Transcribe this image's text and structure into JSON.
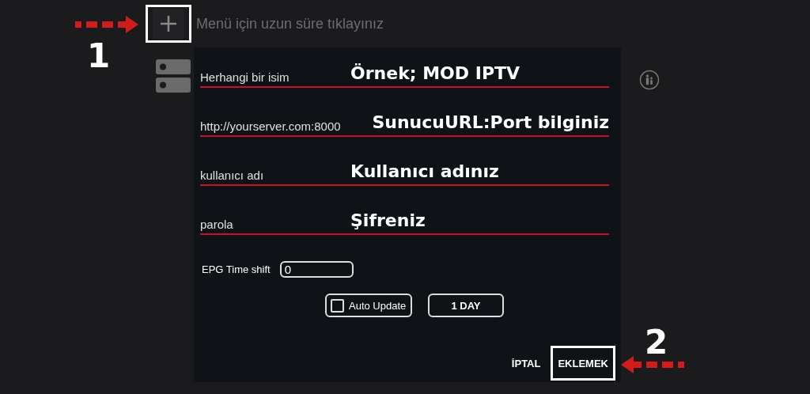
{
  "header": {
    "add_highlighted": true,
    "hint": "Menü için uzun süre tıklayınız"
  },
  "fields": [
    {
      "placeholder": "Herhangi bir isim",
      "annotation": "Örnek; MOD IPTV"
    },
    {
      "placeholder": "http://yourserver.com:8000",
      "annotation": "SunucuURL:Port bilginiz"
    },
    {
      "placeholder": "kullanıcı adı",
      "annotation": "Kullanıcı adınız"
    },
    {
      "placeholder": "parola",
      "annotation": "Şifreniz"
    }
  ],
  "epg": {
    "label": "EPG Time shift",
    "value": "0"
  },
  "auto_update": {
    "label": "Auto Update",
    "checked": false
  },
  "interval_button": "1 DAY",
  "buttons": [
    {
      "label": "İPTAL",
      "highlighted": false
    },
    {
      "label": "EKLEMEK",
      "highlighted": true
    }
  ],
  "callouts": [
    {
      "number": "1"
    },
    {
      "number": "2"
    }
  ]
}
